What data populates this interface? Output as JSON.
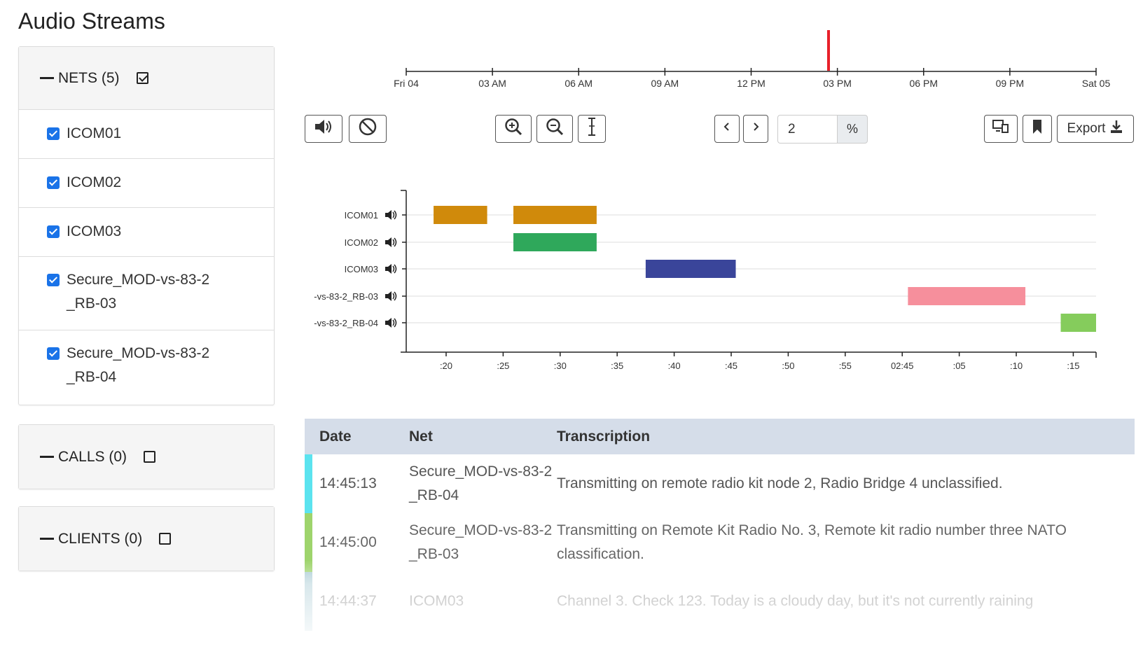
{
  "page": {
    "title": "Audio Streams"
  },
  "sidebar": {
    "nets": {
      "label": "NETS (5)",
      "checked": true,
      "items": [
        {
          "label": "ICOM01",
          "checked": true
        },
        {
          "label": "ICOM02",
          "checked": true
        },
        {
          "label": "ICOM03",
          "checked": true
        },
        {
          "label": "Secure_MOD-vs-83-2_RB-03",
          "checked": true
        },
        {
          "label": "Secure_MOD-vs-83-2_RB-04",
          "checked": true
        }
      ]
    },
    "calls": {
      "label": "CALLS (0)",
      "checked": false
    },
    "clients": {
      "label": "CLIENTS (0)",
      "checked": false
    }
  },
  "overview": {
    "ticks": [
      "Fri 04",
      "03 AM",
      "06 AM",
      "09 AM",
      "12 PM",
      "03 PM",
      "06 PM",
      "09 PM",
      "Sat 05"
    ],
    "marker_time": "14:45",
    "marker_color": "#e8202a"
  },
  "toolbar": {
    "volume_icon": "volume-icon",
    "block_icon": "block-icon",
    "zoom_in_icon": "zoom-in-icon",
    "zoom_out_icon": "zoom-out-icon",
    "cursor_icon": "text-cursor-icon",
    "zoom_value": "2",
    "zoom_unit": "%",
    "export_label": "Export"
  },
  "chart_data": {
    "type": "timeline",
    "rows": [
      "ICOM01",
      "ICOM02",
      "ICOM03",
      "-vs-83-2_RB-03",
      "-vs-83-2_RB-04"
    ],
    "ticks": [
      ":20",
      ":25",
      ":30",
      ":35",
      ":40",
      ":45",
      ":50",
      ":55",
      "02:45",
      ":05",
      ":10",
      ":15"
    ],
    "x_range_minutes": [
      16.5,
      77.0
    ],
    "segments": [
      {
        "row": 0,
        "start": 18.9,
        "end": 23.6,
        "color": "#d08a0b"
      },
      {
        "row": 0,
        "start": 25.9,
        "end": 33.2,
        "color": "#d08a0b"
      },
      {
        "row": 1,
        "start": 25.9,
        "end": 33.2,
        "color": "#2fa85b"
      },
      {
        "row": 2,
        "start": 37.5,
        "end": 45.4,
        "color": "#3a459a"
      },
      {
        "row": 3,
        "start": 60.5,
        "end": 70.8,
        "color": "#f68f9c"
      },
      {
        "row": 4,
        "start": 73.9,
        "end": 77.0,
        "color": "#85cc5c"
      }
    ]
  },
  "table": {
    "headers": {
      "date": "Date",
      "net": "Net",
      "text": "Transcription"
    },
    "rows": [
      {
        "date": "14:45:13",
        "net": "Secure_MOD-vs-83-2_RB-04",
        "text": "Transmitting on remote radio kit node 2, Radio Bridge 4 unclassified.",
        "color": "#5be3ef"
      },
      {
        "date": "14:45:00",
        "net": "Secure_MOD-vs-83-2_RB-03",
        "text": "Transmitting on Remote Kit Radio No. 3, Remote kit radio number three NATO classification.",
        "color": "#9ed46c"
      },
      {
        "date": "14:44:37",
        "net": "ICOM03",
        "text": "Channel 3. Check 123. Today is a cloudy day, but it's not currently raining",
        "color": "#a9cbd4"
      }
    ]
  }
}
